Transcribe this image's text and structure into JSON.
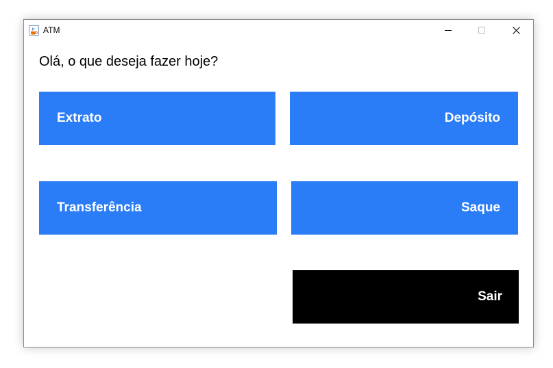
{
  "window": {
    "title": "ATM",
    "app_icon": "java-cup-icon",
    "controls": {
      "minimize": "minimize-icon",
      "maximize": "maximize-icon",
      "close": "close-icon"
    }
  },
  "main": {
    "greeting": "Olá, o que deseja fazer hoje?",
    "buttons": {
      "extrato": "Extrato",
      "deposito": "Depósito",
      "transferencia": "Transferência",
      "saque": "Saque",
      "sair": "Sair"
    }
  },
  "colors": {
    "primary_button": "#2b7df7",
    "exit_button": "#000000",
    "button_text": "#ffffff"
  }
}
